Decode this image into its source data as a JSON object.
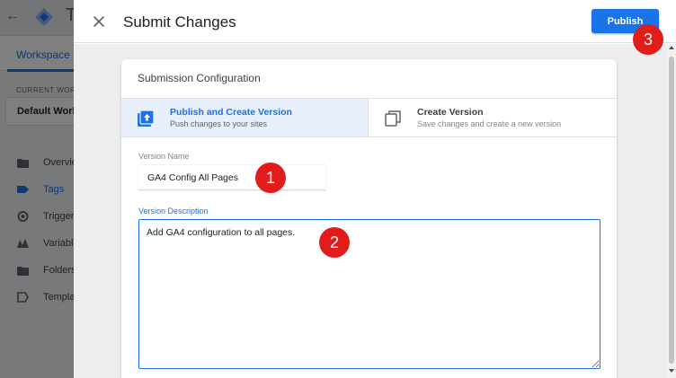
{
  "background_app": {
    "title_initial": "T",
    "tab": "Workspace",
    "current_workspace_label": "CURRENT WORKSPACE",
    "workspace_name": "Default Workspace",
    "nav_items": [
      {
        "label": "Overview",
        "icon": "folder-icon"
      },
      {
        "label": "Tags",
        "icon": "tag-icon"
      },
      {
        "label": "Triggers",
        "icon": "trigger-icon"
      },
      {
        "label": "Variables",
        "icon": "variables-icon"
      },
      {
        "label": "Folders",
        "icon": "folder-icon"
      },
      {
        "label": "Templates",
        "icon": "template-icon"
      }
    ]
  },
  "dialog": {
    "title": "Submit Changes",
    "publish_label": "Publish",
    "card_title": "Submission Configuration",
    "options": [
      {
        "title": "Publish and Create Version",
        "description": "Push changes to your sites"
      },
      {
        "title": "Create Version",
        "description": "Save changes and create a new version"
      }
    ],
    "version_name_label": "Version Name",
    "version_name_value": "GA4 Config All Pages",
    "version_description_label": "Version Description",
    "version_description_value": "Add GA4 configuration to all pages."
  },
  "callouts": [
    "1",
    "2",
    "3"
  ],
  "colors": {
    "accent": "#1a73e8",
    "callout": "#e21b1b",
    "selected_option_bg": "#e8f0fe"
  }
}
